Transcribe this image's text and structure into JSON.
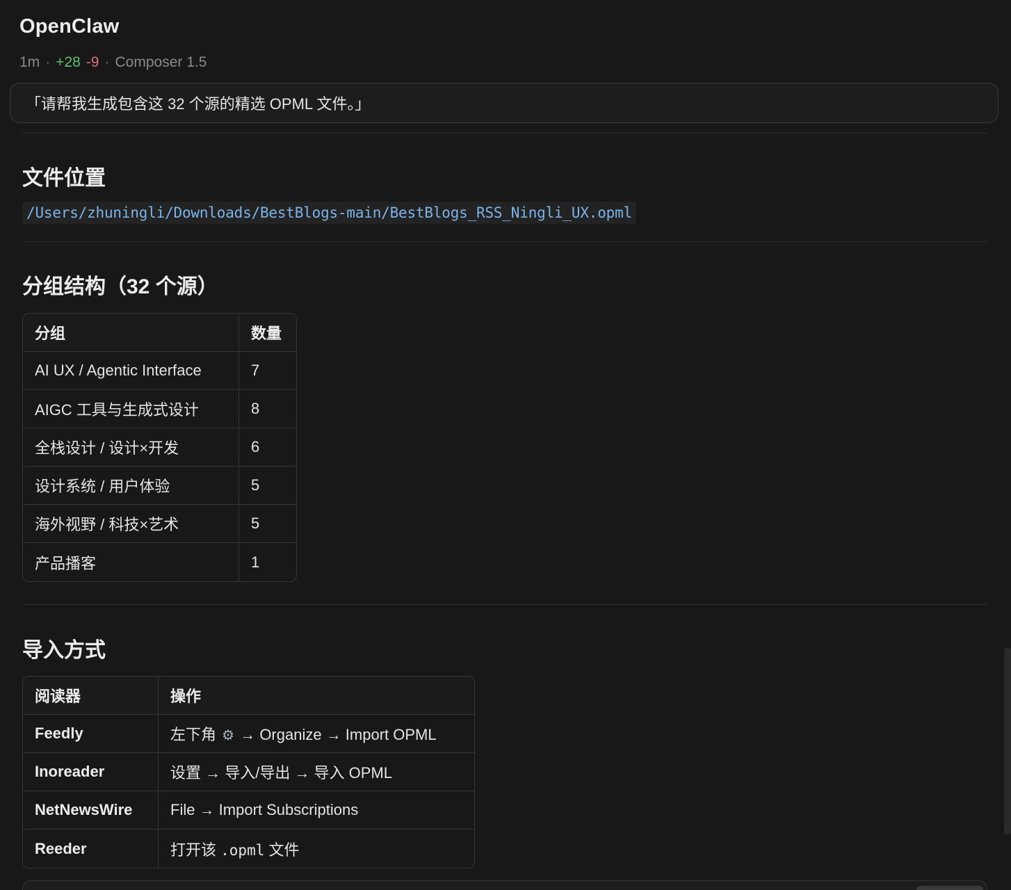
{
  "header": {
    "title": "OpenClaw",
    "time": "1m",
    "additions": "+28",
    "deletions": "-9",
    "model": "Composer 1.5"
  },
  "prompt": "「请帮我生成包含这 32 个源的精选 OPML 文件。」",
  "file_location": {
    "heading": "文件位置",
    "path": "/Users/zhuningli/Downloads/BestBlogs-main/BestBlogs_RSS_Ningli_UX.opml"
  },
  "groups": {
    "heading": "分组结构（32 个源）",
    "columns": [
      "分组",
      "数量"
    ],
    "rows": [
      {
        "group": "AI UX / Agentic Interface",
        "count": "7"
      },
      {
        "group": "AIGC 工具与生成式设计",
        "count": "8"
      },
      {
        "group": "全栈设计 / 设计×开发",
        "count": "6"
      },
      {
        "group": "设计系统 / 用户体验",
        "count": "5"
      },
      {
        "group": "海外视野 / 科技×艺术",
        "count": "5"
      },
      {
        "group": "产品播客",
        "count": "1"
      }
    ]
  },
  "import": {
    "heading": "导入方式",
    "columns": [
      "阅读器",
      "操作"
    ],
    "rows": [
      {
        "reader": "Feedly",
        "pre": "左下角",
        "icon": "⚙",
        "post": "→ Organize → Import OPML"
      },
      {
        "reader": "Inoreader",
        "pre": "设置 → 导入/导出 → 导入 OPML",
        "icon": "",
        "post": ""
      },
      {
        "reader": "NetNewsWire",
        "pre": "File → Import Subscriptions",
        "icon": "",
        "post": ""
      },
      {
        "reader": "Reeder",
        "pre": "打开该",
        "code": ".opml",
        "post": "文件"
      }
    ]
  },
  "colors": {
    "background": "#181818",
    "additions": "#5fbf73",
    "deletions": "#e06c75",
    "path_text": "#7ab4e8"
  }
}
